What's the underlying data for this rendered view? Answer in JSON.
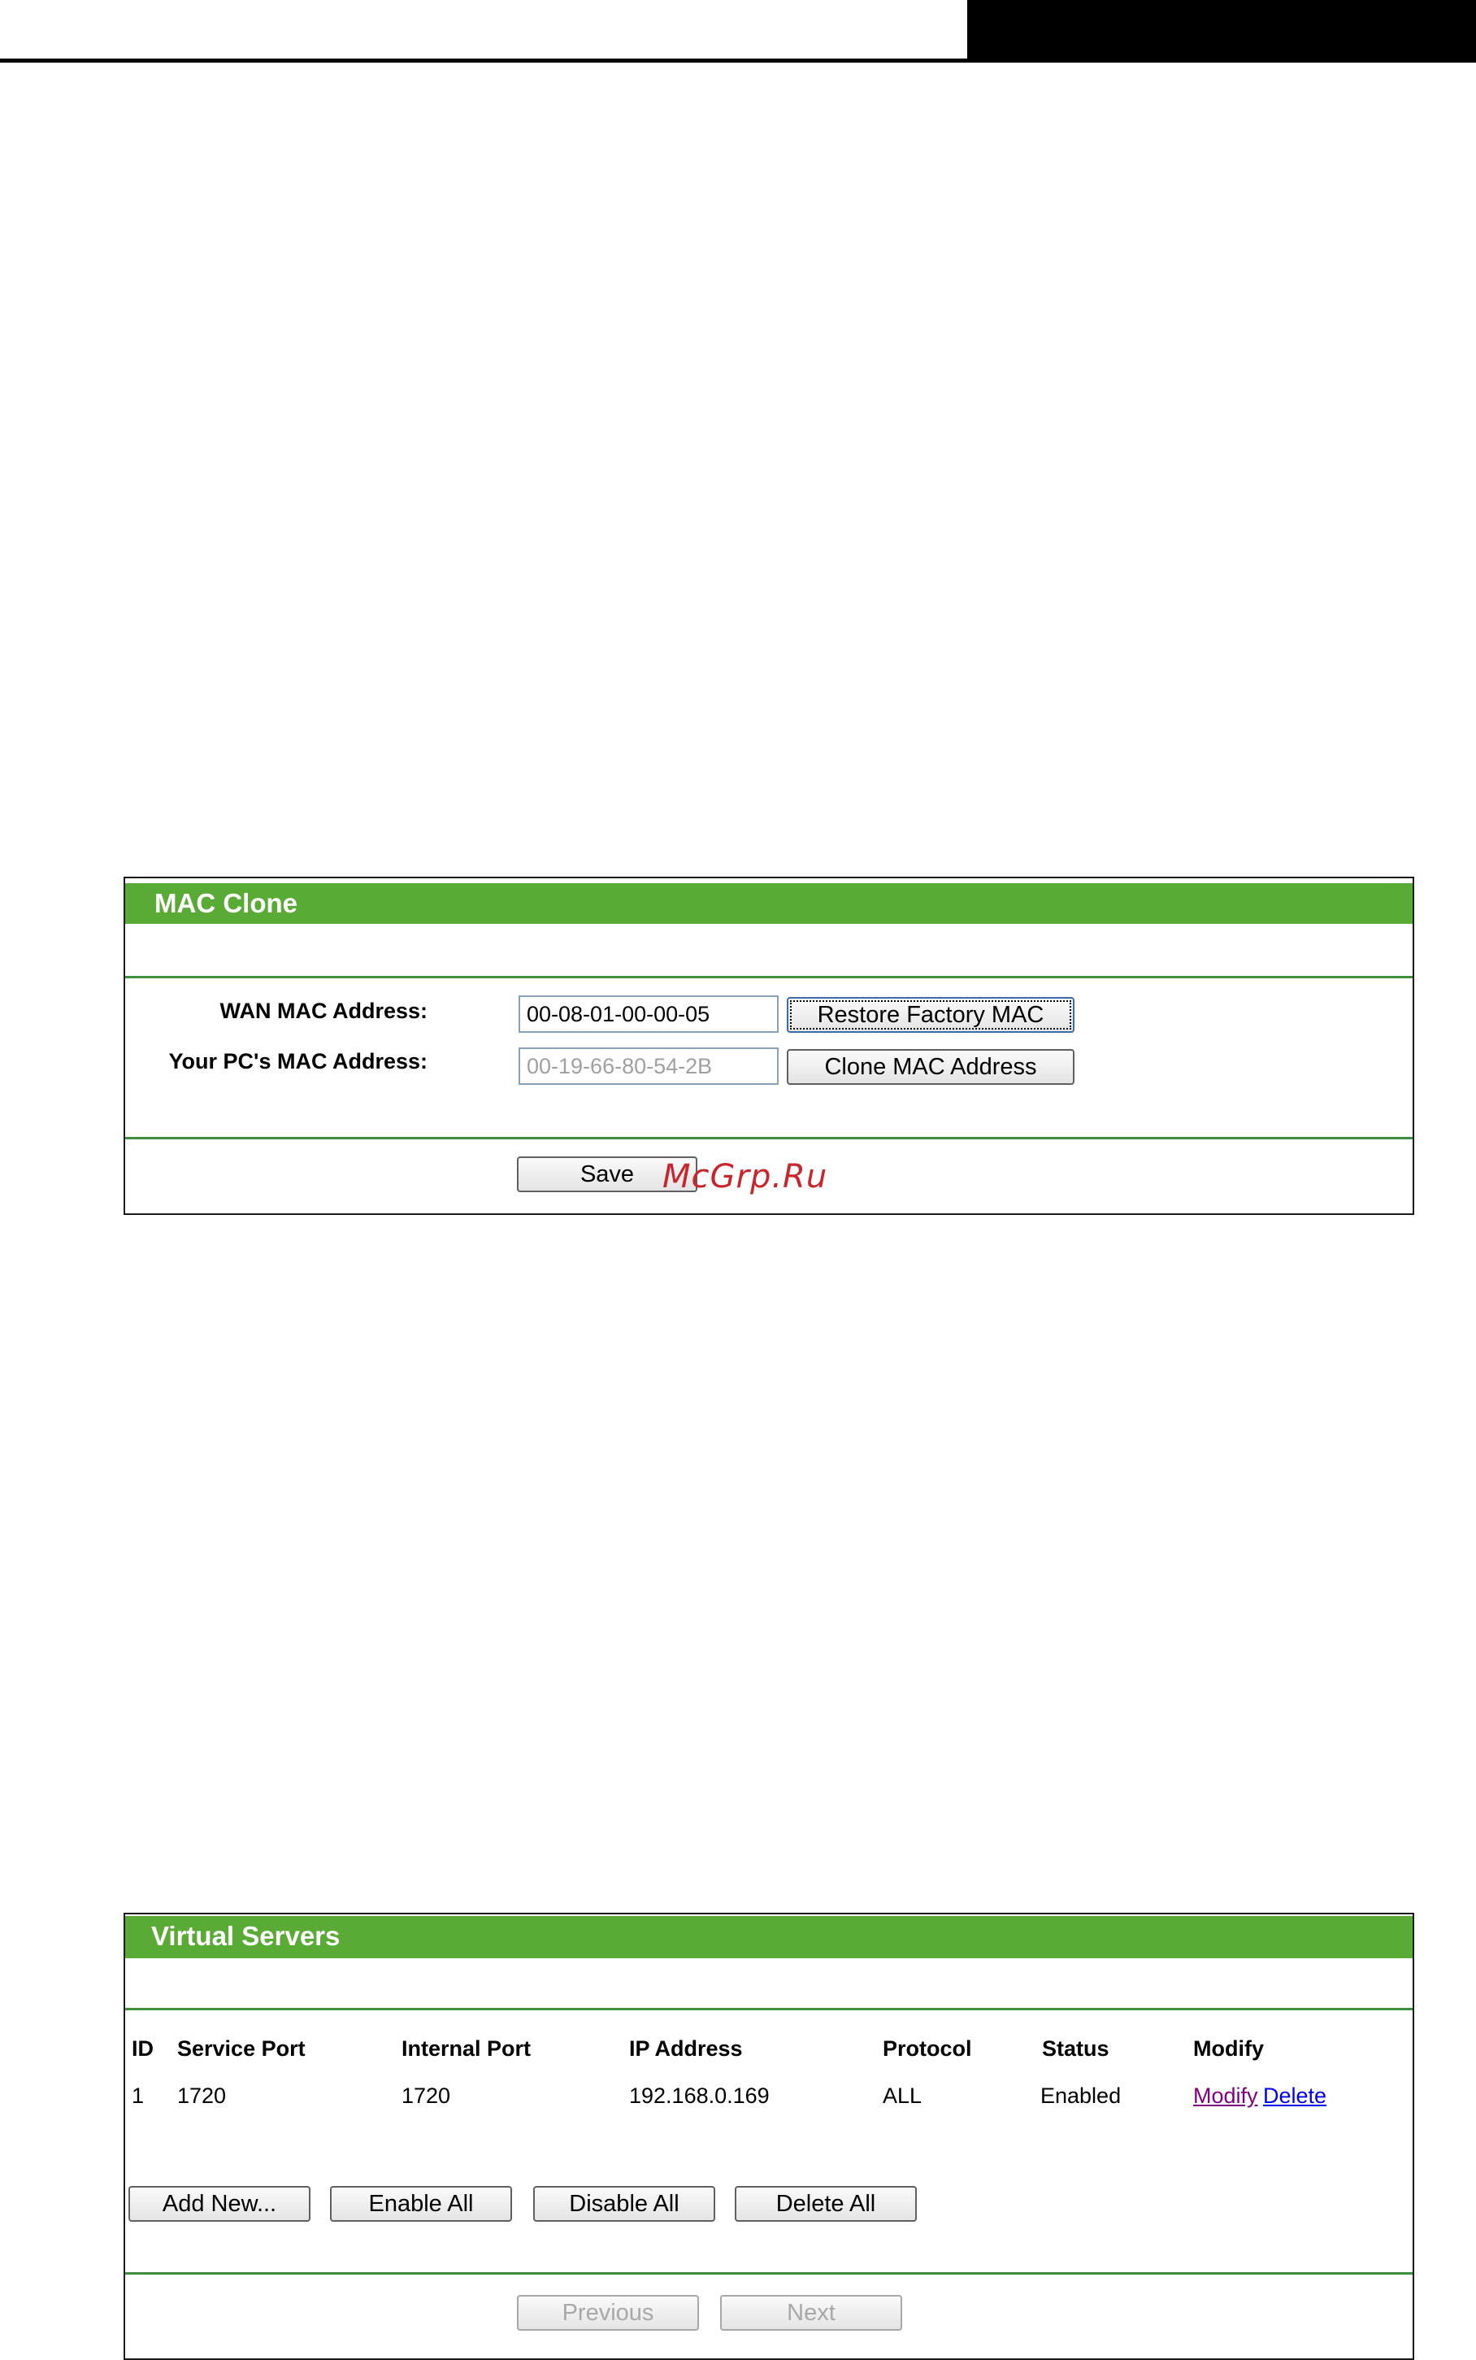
{
  "colors": {
    "panel_header": "#5aab35",
    "divider": "#3d8f3d",
    "link": "#0000ee",
    "visited_link": "#800080",
    "watermark": "#c9252c"
  },
  "watermark": "McGrp.Ru",
  "mac_clone": {
    "title": "MAC Clone",
    "wan_label": "WAN MAC Address:",
    "wan_value": "00-08-01-00-00-05",
    "pc_label": "Your PC's MAC Address:",
    "pc_value": "00-19-66-80-54-2B",
    "restore_button": "Restore Factory MAC",
    "clone_button": "Clone MAC Address",
    "save_button": "Save"
  },
  "virtual_servers": {
    "title": "Virtual Servers",
    "columns": [
      "ID",
      "Service Port",
      "Internal Port",
      "IP Address",
      "Protocol",
      "Status",
      "Modify"
    ],
    "rows": [
      {
        "id": "1",
        "service_port": "1720",
        "internal_port": "1720",
        "ip_address": "192.168.0.169",
        "protocol": "ALL",
        "status": "Enabled",
        "modify_link": "Modify",
        "delete_link": "Delete"
      }
    ],
    "buttons": {
      "add_new": "Add New...",
      "enable_all": "Enable All",
      "disable_all": "Disable All",
      "delete_all": "Delete All",
      "previous": "Previous",
      "next": "Next"
    }
  }
}
